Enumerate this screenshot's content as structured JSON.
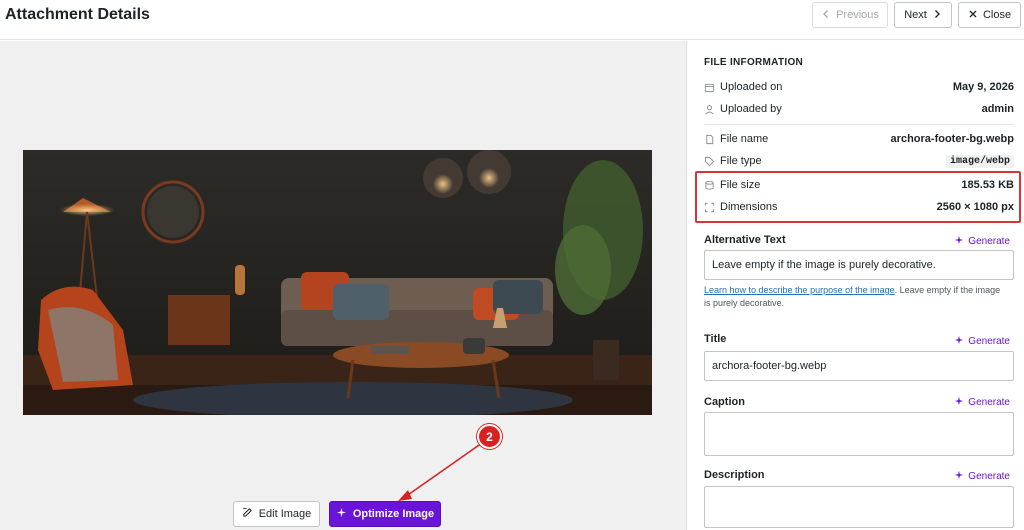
{
  "header": {
    "title": "Attachment Details",
    "previous_label": "Previous",
    "next_label": "Next",
    "close_label": "Close"
  },
  "file_info": {
    "section_title": "FILE INFORMATION",
    "uploaded_on_label": "Uploaded on",
    "uploaded_on_value": "May 9, 2026",
    "uploaded_by_label": "Uploaded by",
    "uploaded_by_value": "admin",
    "file_name_label": "File name",
    "file_name_value": "archora-footer-bg.webp",
    "file_type_label": "File type",
    "file_type_value": "image/webp",
    "file_size_label": "File size",
    "file_size_value": "185.53 KB",
    "dimensions_label": "Dimensions",
    "dimensions_value": "2560 × 1080 px"
  },
  "fields": {
    "generate_label": "Generate",
    "alt_label": "Alternative Text",
    "alt_value": "Leave empty if the image is purely decorative.",
    "alt_help_link": "Learn how to describe the purpose of the image",
    "alt_help_text": ". Leave empty if the image is purely decorative.",
    "title_label": "Title",
    "title_value": "archora-footer-bg.webp",
    "caption_label": "Caption",
    "description_label": "Description"
  },
  "actions": {
    "edit_label": "Edit Image",
    "optimize_label": "Optimize Image"
  },
  "annotation": {
    "step_number": "2"
  },
  "colors": {
    "accent": "#6b14d9",
    "highlight": "#d63638"
  }
}
